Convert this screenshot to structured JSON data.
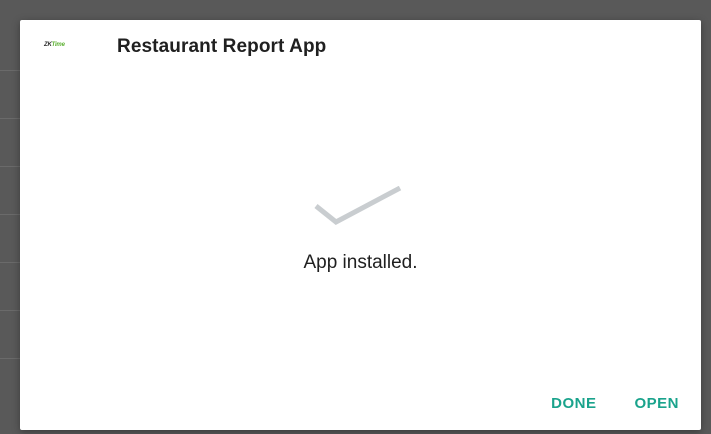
{
  "dialog": {
    "app_icon": {
      "brand_left": "ZK",
      "brand_right": "Time",
      "icon_name": "zktime-logo-icon"
    },
    "title": "Restaurant Report App",
    "status_icon": "checkmark-icon",
    "status_text": "App installed.",
    "actions": {
      "done_label": "DONE",
      "open_label": "OPEN"
    }
  },
  "colors": {
    "accent": "#1aa38c",
    "checkmark": "#c9cdd0",
    "backdrop": "#595959"
  }
}
